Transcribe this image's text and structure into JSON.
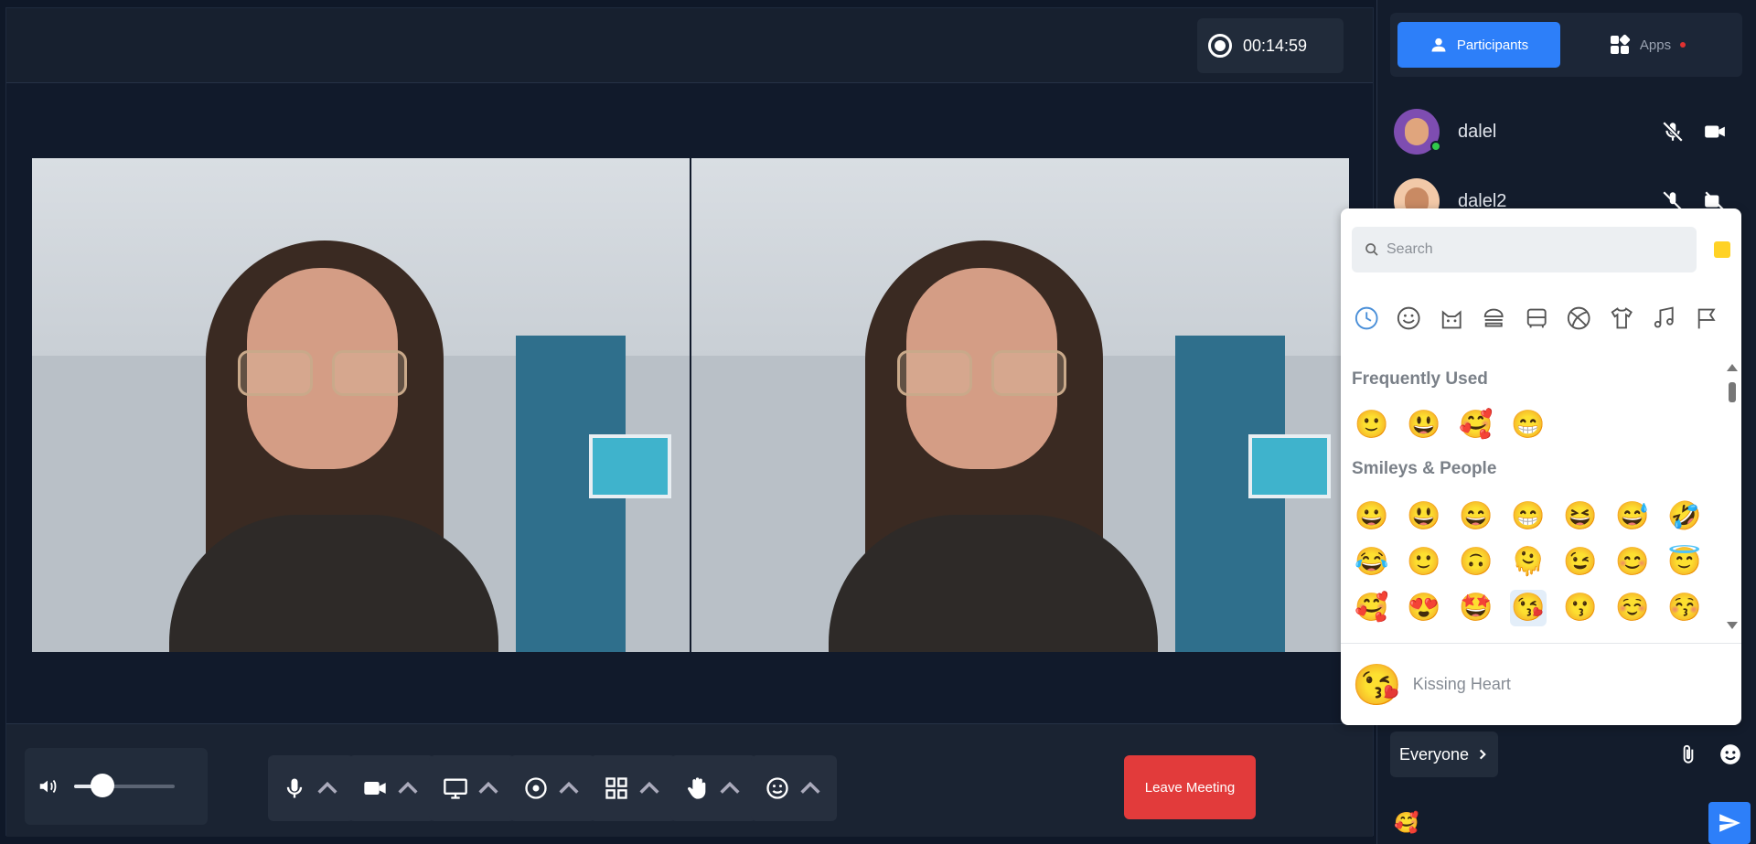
{
  "meeting": {
    "recording_time": "00:14:59",
    "leave_label": "Leave Meeting",
    "volume_level": 0.28
  },
  "controls": [
    {
      "name": "microphone-control",
      "icon": "microphone-icon"
    },
    {
      "name": "camera-control",
      "icon": "video-camera-icon"
    },
    {
      "name": "screen-share-control",
      "icon": "monitor-icon"
    },
    {
      "name": "record-control",
      "icon": "record-icon"
    },
    {
      "name": "layout-control",
      "icon": "grid-icon"
    },
    {
      "name": "raise-hand-control",
      "icon": "hand-icon"
    },
    {
      "name": "reactions-control",
      "icon": "smiley-icon"
    }
  ],
  "sidebar": {
    "tabs": {
      "participants": "Participants",
      "apps": "Apps"
    },
    "participants": [
      {
        "name": "dalel",
        "online": true,
        "mic": "muted",
        "camera": "on"
      },
      {
        "name": "dalel2",
        "online": false,
        "mic": "muted",
        "camera": "off"
      }
    ],
    "chat_target": "Everyone",
    "message_draft": "🥰"
  },
  "emoji_picker": {
    "search_placeholder": "Search",
    "categories": [
      "recent-icon",
      "smileys-icon",
      "animals-icon",
      "food-icon",
      "travel-icon",
      "activity-icon",
      "objects-icon",
      "symbols-icon",
      "flags-icon"
    ],
    "sections": {
      "frequently_used": {
        "title": "Frequently Used",
        "emojis": [
          "🙂",
          "😃",
          "🥰",
          "😁"
        ]
      },
      "smileys": {
        "title": "Smileys & People",
        "rows": [
          [
            "😀",
            "😃",
            "😄",
            "😁",
            "😆",
            "😅",
            "🤣"
          ],
          [
            "😂",
            "🙂",
            "🙃",
            "🫠",
            "😉",
            "😊",
            "😇"
          ],
          [
            "🥰",
            "😍",
            "🤩",
            "😘",
            "😗",
            "☺️",
            "😚"
          ]
        ]
      }
    },
    "preview": {
      "emoji": "😘",
      "name": "Kissing Heart"
    }
  }
}
